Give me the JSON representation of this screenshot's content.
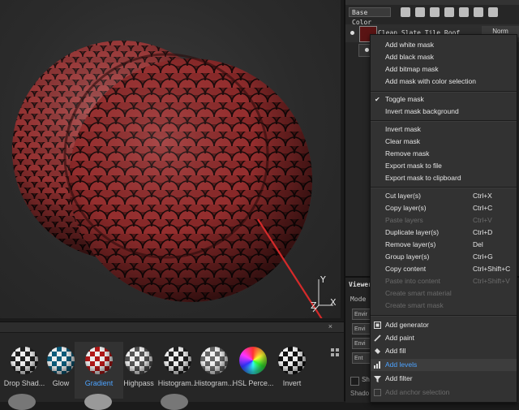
{
  "layers_panel": {
    "channel_select": "Base Color",
    "layer_name": "Clean Slate Tile Roof",
    "blend_mode": "Norm"
  },
  "viewer": {
    "title": "Viewer",
    "mode_label": "Mode",
    "env_rows": [
      "Envir",
      "Envi",
      "Envi",
      "Ent"
    ],
    "shadow_label": "Shado",
    "check_label": "Shr"
  },
  "viewport": {
    "axis_x": "X",
    "axis_y": "Y",
    "axis_z": "Z"
  },
  "shelf": {
    "close": "×",
    "items": [
      {
        "label": "Drop Shad..."
      },
      {
        "label": "Glow"
      },
      {
        "label": "Gradient",
        "selected": true
      },
      {
        "label": "Highpass"
      },
      {
        "label": "Histogram..."
      },
      {
        "label": "Histogram..."
      },
      {
        "label": "HSL Perce..."
      },
      {
        "label": "Invert"
      }
    ]
  },
  "context_menu": {
    "items": [
      {
        "label": "Add white mask"
      },
      {
        "label": "Add black mask"
      },
      {
        "label": "Add bitmap mask"
      },
      {
        "label": "Add mask with color selection"
      },
      {
        "label": "Toggle mask",
        "checked": true
      },
      {
        "label": "Invert mask background"
      },
      {
        "label": "Invert mask"
      },
      {
        "label": "Clear mask"
      },
      {
        "label": "Remove mask"
      },
      {
        "label": "Export mask to file"
      },
      {
        "label": "Export mask to clipboard"
      },
      {
        "label": "Cut layer(s)",
        "shortcut": "Ctrl+X"
      },
      {
        "label": "Copy layer(s)",
        "shortcut": "Ctrl+C"
      },
      {
        "label": "Paste layers",
        "shortcut": "Ctrl+V",
        "disabled": true
      },
      {
        "label": "Duplicate layer(s)",
        "shortcut": "Ctrl+D"
      },
      {
        "label": "Remove layer(s)",
        "shortcut": "Del"
      },
      {
        "label": "Group layer(s)",
        "shortcut": "Ctrl+G"
      },
      {
        "label": "Copy content",
        "shortcut": "Ctrl+Shift+C"
      },
      {
        "label": "Paste into content",
        "shortcut": "Ctrl+Shift+V",
        "disabled": true
      },
      {
        "label": "Create smart material",
        "disabled": true
      },
      {
        "label": "Create smart mask",
        "disabled": true
      },
      {
        "label": "Add generator",
        "icon": "generator-icon"
      },
      {
        "label": "Add paint",
        "icon": "paint-brush-icon"
      },
      {
        "label": "Add fill",
        "icon": "fill-bucket-icon"
      },
      {
        "label": "Add levels",
        "icon": "levels-icon",
        "highlighted": true
      },
      {
        "label": "Add filter",
        "icon": "filter-icon"
      },
      {
        "label": "Add anchor selection",
        "icon": "anchor-icon",
        "disabled": true
      }
    ]
  },
  "colors": {
    "accent": "#4da3ff",
    "arrow": "#d42a2a",
    "tile": "#8a2626"
  }
}
